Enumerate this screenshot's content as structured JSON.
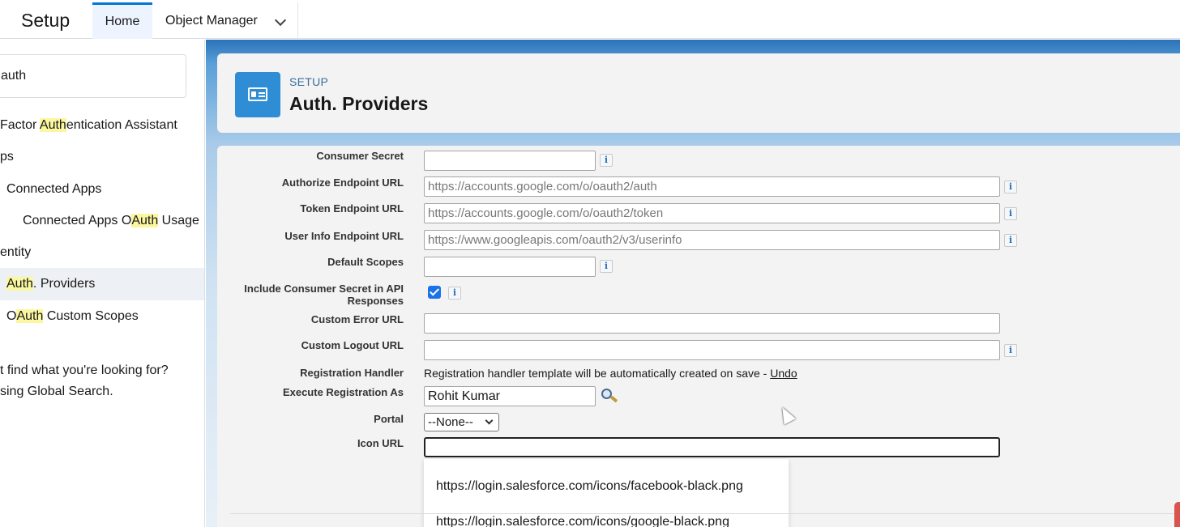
{
  "topbar": {
    "app_title": "Setup",
    "tabs": [
      {
        "label": "Home"
      },
      {
        "label": "Object Manager"
      }
    ]
  },
  "sidebar": {
    "search_value": "auth",
    "items": [
      {
        "pre": "Factor ",
        "hl": "Auth",
        "post": "entication Assistant"
      },
      {
        "pre": "ps",
        "hl": "",
        "post": ""
      },
      {
        "pre": "Connected Apps",
        "hl": "",
        "post": ""
      },
      {
        "pre": "Connected Apps O",
        "hl": "Auth",
        "post": " Usage"
      },
      {
        "pre": "entity",
        "hl": "",
        "post": ""
      },
      {
        "pre": "",
        "hl": "Auth",
        "post": ". Providers"
      },
      {
        "pre": "O",
        "hl": "Auth",
        "post": " Custom Scopes"
      }
    ],
    "help_line1": "t find what you're looking for?",
    "help_line2": "sing Global Search."
  },
  "header": {
    "eyebrow": "SETUP",
    "title": "Auth. Providers"
  },
  "form": {
    "consumer_secret": {
      "label": "Consumer Secret",
      "value": ""
    },
    "authorize_endpoint": {
      "label": "Authorize Endpoint URL",
      "value": "https://accounts.google.com/o/oauth2/auth"
    },
    "token_endpoint": {
      "label": "Token Endpoint URL",
      "value": "https://accounts.google.com/o/oauth2/token"
    },
    "user_info_endpoint": {
      "label": "User Info Endpoint URL",
      "value": "https://www.googleapis.com/oauth2/v3/userinfo"
    },
    "default_scopes": {
      "label": "Default Scopes",
      "value": ""
    },
    "include_secret": {
      "label_line1": "Include Consumer Secret in API",
      "label_line2": "Responses",
      "checked": true
    },
    "custom_error_url": {
      "label": "Custom Error URL",
      "value": ""
    },
    "custom_logout_url": {
      "label": "Custom Logout URL",
      "value": ""
    },
    "registration_handler": {
      "label": "Registration Handler",
      "text": "Registration handler template will be automatically created on save - ",
      "undo": "Undo"
    },
    "execute_as": {
      "label": "Execute Registration As",
      "value": "Rohit Kumar"
    },
    "portal": {
      "label": "Portal",
      "selected": "--None--"
    },
    "icon_url": {
      "label": "Icon URL",
      "value": ""
    },
    "info_glyph": "i"
  },
  "icon_dropdown": {
    "options": [
      "https://login.salesforce.com/icons/facebook-black.png",
      "https://login.salesforce.com/icons/google-black.png"
    ]
  },
  "colors": {
    "accent": "#0176d3",
    "header_icon": "#2e8dd4",
    "highlight": "#fbf7a1"
  }
}
